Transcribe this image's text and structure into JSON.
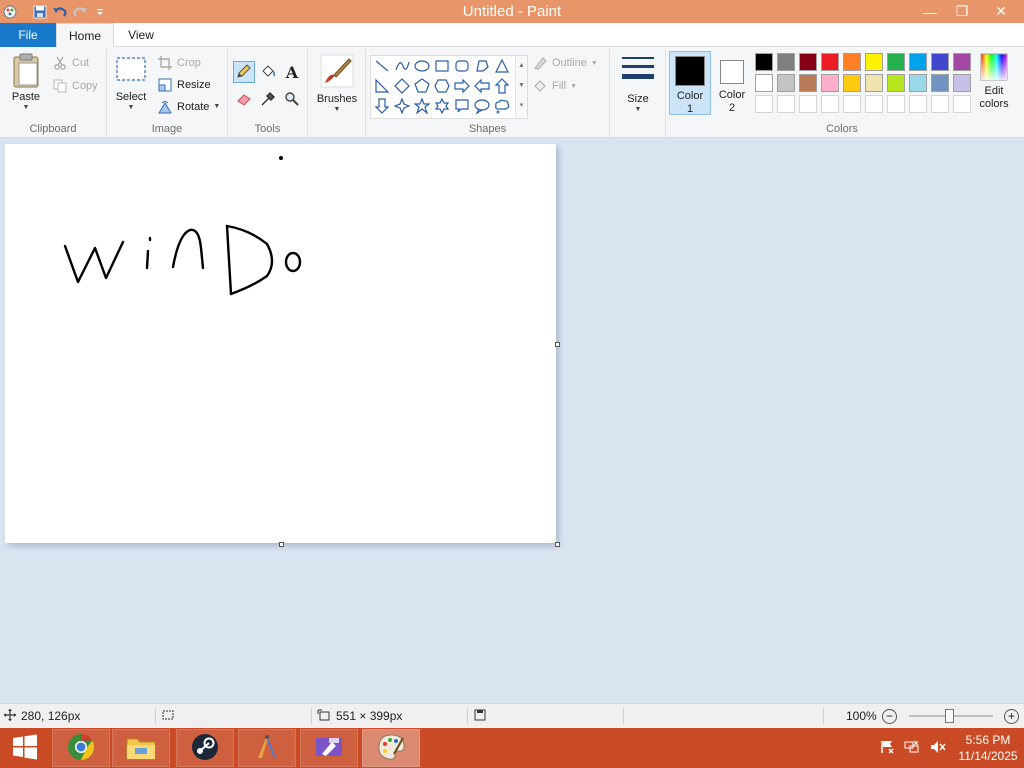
{
  "titlebar": {
    "title": "Untitled - Paint",
    "minimize_glyph": "—",
    "maximize_glyph": "❐",
    "close_glyph": "✕"
  },
  "tabs": {
    "file": "File",
    "home": "Home",
    "view": "View"
  },
  "clipboard": {
    "label": "Clipboard",
    "paste": "Paste",
    "cut": "Cut",
    "copy": "Copy"
  },
  "image": {
    "label": "Image",
    "select": "Select",
    "crop": "Crop",
    "resize": "Resize",
    "rotate": "Rotate"
  },
  "tools": {
    "label": "Tools",
    "text_glyph": "A"
  },
  "brushes": {
    "label": "Brushes"
  },
  "shapes": {
    "label": "Shapes",
    "outline": "Outline",
    "fill": "Fill"
  },
  "size": {
    "label": "Size"
  },
  "color1": {
    "label_line1": "Color",
    "label_line2": "1",
    "color": "#000000"
  },
  "color2": {
    "label_line1": "Color",
    "label_line2": "2",
    "color": "#ffffff"
  },
  "colors": {
    "label": "Colors",
    "edit_line1": "Edit",
    "edit_line2": "colors",
    "row1": [
      "#000000",
      "#7f7f7f",
      "#880015",
      "#ed1c24",
      "#ff7f27",
      "#fff200",
      "#22b14c",
      "#00a2e8",
      "#3f48cc",
      "#a349a4"
    ],
    "row2": [
      "#ffffff",
      "#c3c3c3",
      "#b97a57",
      "#ffaec9",
      "#ffc90e",
      "#efe4b0",
      "#b5e61d",
      "#99d9ea",
      "#7092be",
      "#c8bfe7"
    ]
  },
  "statusbar": {
    "cursor_pos": "280, 126px",
    "canvas_size": "551 × 399px",
    "zoom": "100%",
    "zoom_out": "−",
    "zoom_in": "+"
  },
  "taskbar": {
    "time": "5:56 PM",
    "date": "11/14/2025"
  },
  "theme": {
    "titlebar": "#e8956a",
    "file_tab": "#1979ca",
    "taskbar": "#c94a25",
    "workspace": "#d9e4f1"
  }
}
